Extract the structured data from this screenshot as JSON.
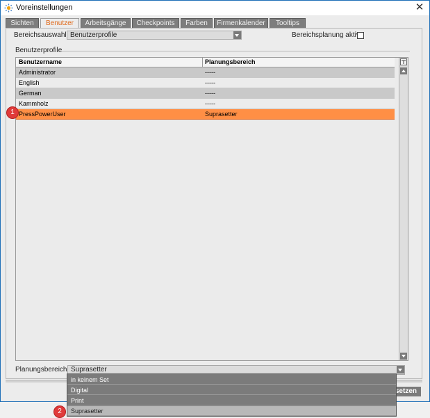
{
  "window": {
    "title": "Voreinstellungen",
    "close_glyph": "✕"
  },
  "tabs": [
    {
      "label": "Sichten",
      "active": false
    },
    {
      "label": "Benutzer",
      "active": true
    },
    {
      "label": "Arbeitsgänge",
      "active": false
    },
    {
      "label": "Checkpoints",
      "active": false
    },
    {
      "label": "Farben",
      "active": false
    },
    {
      "label": "Firmenkalender",
      "active": false
    },
    {
      "label": "Tooltips",
      "active": false
    }
  ],
  "bereichsauswahl": {
    "label": "Bereichsauswahl",
    "value": "Benutzerprofile"
  },
  "bereichsplanung": {
    "label": "Bereichsplanung aktiv:",
    "checked": false
  },
  "group": {
    "title": "Benutzerprofile"
  },
  "table": {
    "columns": [
      "Benutzername",
      "Planungsbereich"
    ],
    "rows": [
      {
        "name": "Administrator",
        "bereich": "-----"
      },
      {
        "name": "English",
        "bereich": "-----"
      },
      {
        "name": "German",
        "bereich": "-----"
      },
      {
        "name": "Kammholz",
        "bereich": "-----"
      },
      {
        "name": "PressPowerUser",
        "bereich": "Suprasetter",
        "selected": true
      }
    ]
  },
  "planungsbereich": {
    "label": "Planungsbereich:",
    "value": "Suprasetter",
    "options": [
      "in keinem Set",
      "Digital",
      "Print",
      "Suprasetter"
    ]
  },
  "bottom_button": {
    "label": "setzen"
  },
  "badges": {
    "one": "1",
    "two": "2"
  },
  "colors": {
    "accent": "#e06a1b",
    "selected_row": "#ff8f45",
    "badge": "#e03a3a"
  }
}
